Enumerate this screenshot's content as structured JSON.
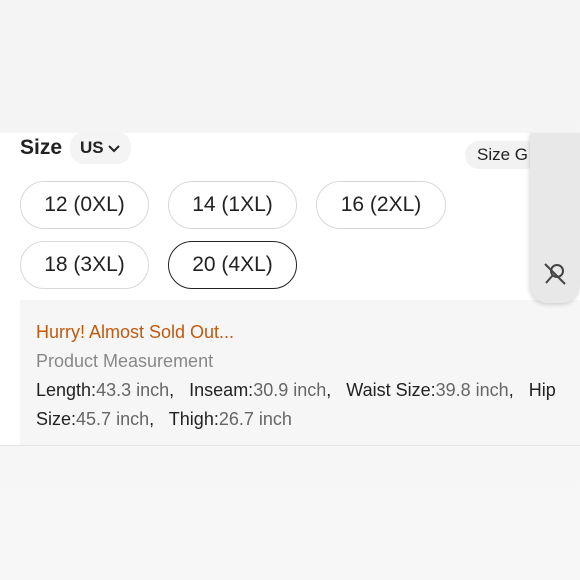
{
  "size": {
    "title": "Size",
    "region": "US",
    "guide_label": "Size G"
  },
  "chips": [
    {
      "label": "12 (0XL)",
      "selected": false
    },
    {
      "label": "14 (1XL)",
      "selected": false
    },
    {
      "label": "16 (2XL)",
      "selected": false
    },
    {
      "label": "18 (3XL)",
      "selected": false
    },
    {
      "label": "20 (4XL)",
      "selected": true
    }
  ],
  "info": {
    "stock_warning": "Hurry! Almost Sold Out...",
    "measurement_title": "Product Measurement",
    "measurements": [
      {
        "label": "Length:",
        "value": "43.3 inch"
      },
      {
        "label": "Inseam:",
        "value": "30.9 inch"
      },
      {
        "label": "Waist Size:",
        "value": "39.8 inch"
      },
      {
        "label": "Hip Size:",
        "value": "45.7 inch"
      },
      {
        "label": "Thigh:",
        "value": "26.7 inch"
      }
    ]
  },
  "colors": {
    "warning": "#c05a10",
    "muted": "#888888"
  },
  "icons": {
    "region_dropdown": "chevron-down-icon",
    "side_tab": "no-pin-icon"
  }
}
